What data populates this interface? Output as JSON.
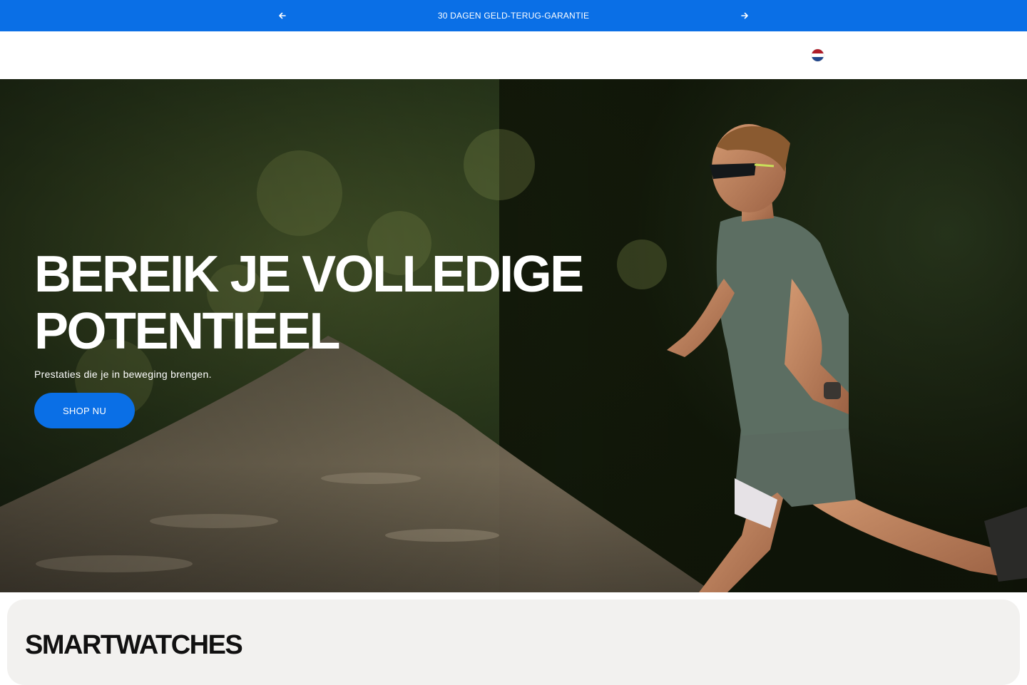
{
  "announcement": {
    "message": "30 DAGEN GELD-TERUG-GARANTIE",
    "prev_icon": "arrow-left-icon",
    "next_icon": "arrow-right-icon",
    "background": "#0a6fe6"
  },
  "header": {
    "language_flag": "netherlands-flag-icon",
    "flag_colors": [
      "#ae1c28",
      "#ffffff",
      "#21468b"
    ]
  },
  "hero": {
    "title": "BEREIK JE VOLLEDIGE POTENTIEEL",
    "subtitle": "Prestaties die je in beweging brengen.",
    "cta_label": "SHOP NU",
    "accent": "#0a6fe6"
  },
  "section": {
    "title": "SMARTWATCHES"
  }
}
